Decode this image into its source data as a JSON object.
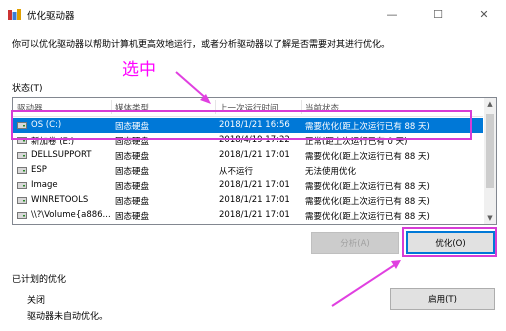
{
  "window": {
    "title": "优化驱动器",
    "controls": {
      "minimize": "—",
      "maximize": "☐",
      "close": "✕"
    }
  },
  "description": "你可以优化驱动器以帮助计算机更高效地运行，或者分析驱动器以了解是否需要对其进行优化。",
  "status_label": "状态(T)",
  "annotation": {
    "label": "选中",
    "color": "#ff00ff"
  },
  "table": {
    "columns": [
      "驱动器",
      "媒体类型",
      "上一次运行时间",
      "当前状态"
    ],
    "rows": [
      {
        "drive": "OS (C:)",
        "media": "固态硬盘",
        "last_run": "2018/1/21 16:56",
        "status": "需要优化(距上次运行已有 88 天)",
        "selected": true
      },
      {
        "drive": "新加卷 (E:)",
        "media": "固态硬盘",
        "last_run": "2018/4/19 17:22",
        "status": "正常(距上次运行已有 0 天)",
        "selected": false
      },
      {
        "drive": "DELLSUPPORT",
        "media": "固态硬盘",
        "last_run": "2018/1/21 17:01",
        "status": "需要优化(距上次运行已有 88 天)",
        "selected": false
      },
      {
        "drive": "ESP",
        "media": "固态硬盘",
        "last_run": "从不运行",
        "status": "无法使用优化",
        "selected": false
      },
      {
        "drive": "Image",
        "media": "固态硬盘",
        "last_run": "2018/1/21 17:01",
        "status": "需要优化(距上次运行已有 88 天)",
        "selected": false
      },
      {
        "drive": "WINRETOOLS",
        "media": "固态硬盘",
        "last_run": "2018/1/21 17:01",
        "status": "需要优化(距上次运行已有 88 天)",
        "selected": false
      },
      {
        "drive": "\\\\?\\Volume{a886...",
        "media": "固态硬盘",
        "last_run": "2018/1/21 17:01",
        "status": "需要优化(距上次运行已有 88 天)",
        "selected": false
      }
    ]
  },
  "buttons": {
    "analyze": "分析(A)",
    "optimize": "优化(O)",
    "enable": "启用(T)"
  },
  "scheduled": {
    "label": "已计划的优化",
    "state": "关闭",
    "desc": "驱动器未自动优化。"
  }
}
